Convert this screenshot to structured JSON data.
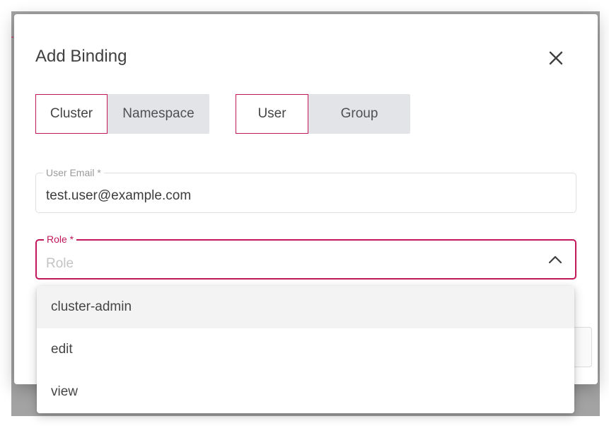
{
  "dialog": {
    "title": "Add Binding",
    "close_icon": "close-icon"
  },
  "scope_toggle": {
    "options": [
      {
        "label": "Cluster",
        "selected": true
      },
      {
        "label": "Namespace",
        "selected": false
      }
    ]
  },
  "subject_toggle": {
    "options": [
      {
        "label": "User",
        "selected": true
      },
      {
        "label": "Group",
        "selected": false
      }
    ]
  },
  "user_email": {
    "label": "User Email *",
    "value": "test.user@example.com"
  },
  "role": {
    "label": "Role *",
    "placeholder": "Role",
    "value": "",
    "open": true,
    "chevron_icon": "chevron-up-icon",
    "options": [
      "cluster-admin",
      "edit",
      "view"
    ],
    "highlighted_option": "cluster-admin"
  },
  "colors": {
    "accent": "#c2185b",
    "toggle_bg": "#e2e4e8",
    "backdrop": "#a3a3a3"
  }
}
